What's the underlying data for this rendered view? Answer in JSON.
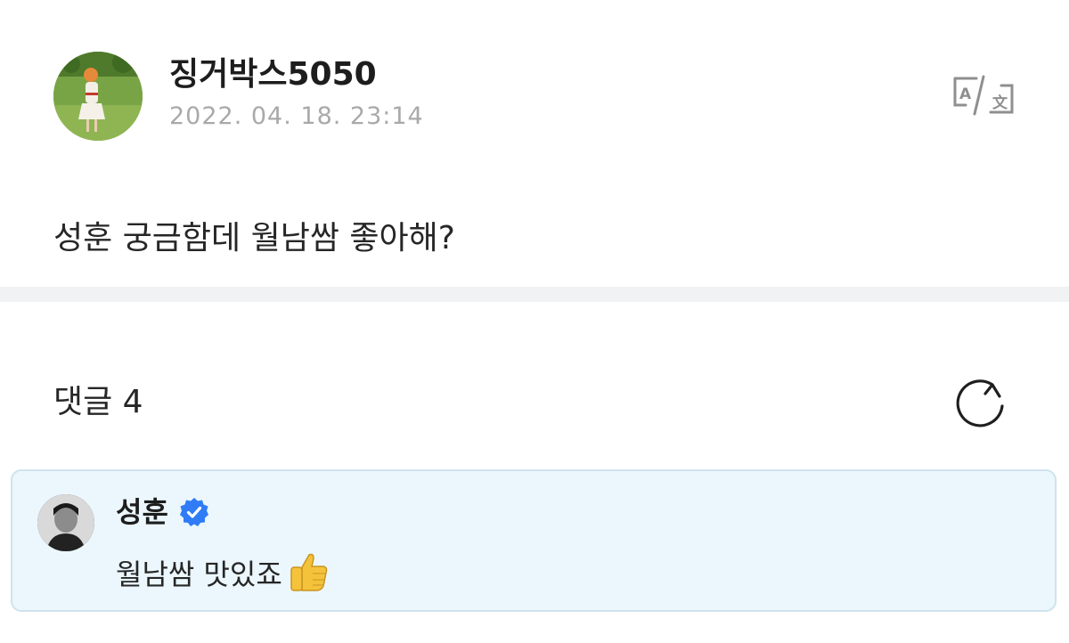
{
  "post": {
    "author": "징거박스5050",
    "date": "2022. 04. 18. 23:14",
    "body": "성훈 궁금함데 월남쌈 좋아해?",
    "translate_icon": "translate-icon"
  },
  "comments": {
    "title": "댓글 4",
    "refresh_icon": "refresh-icon",
    "highlighted": {
      "author": "성훈",
      "verified": true,
      "text": "월남쌈 맛있죠",
      "emoji": "thumbs-up-icon"
    }
  },
  "colors": {
    "accent_blue": "#2f7cf6",
    "date_gray": "#a9a9a9",
    "divider": "#f1f2f4",
    "comment_bg": "#ebf7fd",
    "comment_border": "#cfe3ee"
  }
}
